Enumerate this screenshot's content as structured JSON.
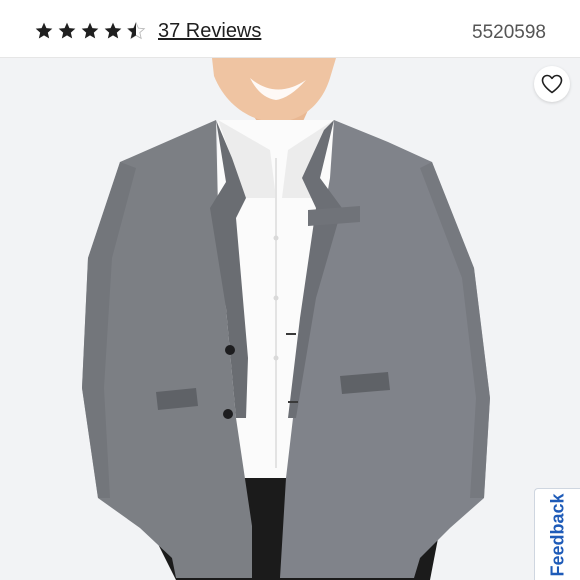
{
  "rating": {
    "value": 4.5,
    "max": 5
  },
  "reviews": {
    "label": "37 Reviews"
  },
  "product": {
    "sku": "5520598",
    "image_description": "Model wearing a gray textured two-button blazer over a white dress shirt with black trousers"
  },
  "favorite": {
    "icon": "heart-outline-icon"
  },
  "feedback": {
    "label": "Feedback",
    "color": "#1e5bb8"
  },
  "colors": {
    "star": "#1f1f1f",
    "blazer": "#7c7f84"
  }
}
